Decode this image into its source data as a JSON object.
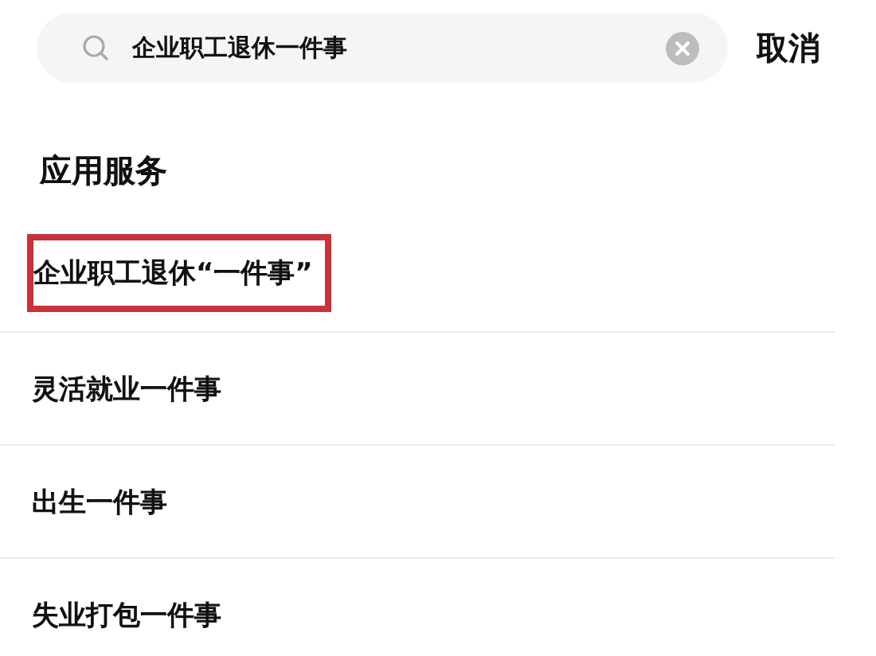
{
  "search": {
    "value": "企业职工退休一件事"
  },
  "cancel_button": "取消",
  "section": {
    "title": "应用服务",
    "items": [
      {
        "label": "企业职工退休“一件事”",
        "highlighted": true
      },
      {
        "label": "灵活就业一件事",
        "highlighted": false
      },
      {
        "label": "出生一件事",
        "highlighted": false
      },
      {
        "label": "失业打包一件事",
        "highlighted": false
      }
    ]
  }
}
